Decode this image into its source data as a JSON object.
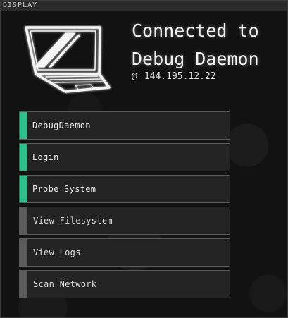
{
  "window": {
    "title": "DISPLAY"
  },
  "header": {
    "line1": "Connected to",
    "line2": "Debug Daemon",
    "at_symbol": "@",
    "ip": "144.195.12.22",
    "icon": "laptop-icon"
  },
  "colors": {
    "accent_active": "#2fbf8a",
    "accent_inactive": "#5c5c5c"
  },
  "menu": {
    "items": [
      {
        "label": "DebugDaemon",
        "active": true
      },
      {
        "label": "Login",
        "active": true
      },
      {
        "label": "Probe System",
        "active": true
      },
      {
        "label": "View Filesystem",
        "active": false
      },
      {
        "label": "View Logs",
        "active": false
      },
      {
        "label": "Scan Network",
        "active": false
      }
    ]
  }
}
